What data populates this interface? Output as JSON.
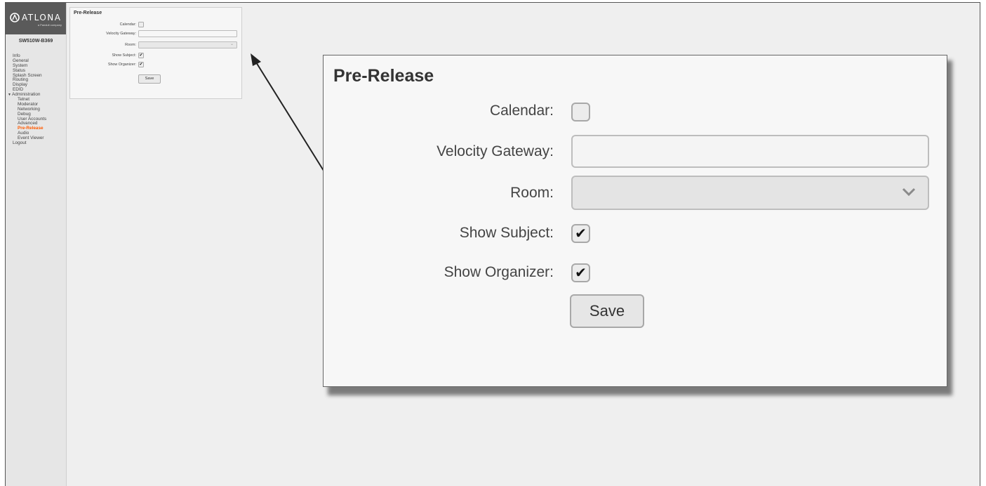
{
  "brand": {
    "logo_text": "ATLONA",
    "logo_sub": "a Panduit company",
    "accent_color": "#ff5a00"
  },
  "device": {
    "name": "SW510W-B369"
  },
  "sidebar": {
    "items": [
      {
        "label": "Info"
      },
      {
        "label": "General"
      },
      {
        "label": "System"
      },
      {
        "label": "Status"
      },
      {
        "label": "Splash Screen"
      },
      {
        "label": "Routing"
      },
      {
        "label": "Display"
      },
      {
        "label": "EDID"
      },
      {
        "label": "Administration",
        "expanded": true
      },
      {
        "label": "Telnet"
      },
      {
        "label": "Moderator"
      },
      {
        "label": "Networking"
      },
      {
        "label": "Debug"
      },
      {
        "label": "User Accounts"
      },
      {
        "label": "Advanced"
      },
      {
        "label": "Pre-Release",
        "active": true
      },
      {
        "label": "Audio"
      },
      {
        "label": "Event Viewer"
      },
      {
        "label": "Logout"
      }
    ]
  },
  "form": {
    "title": "Pre-Release",
    "calendar_label": "Calendar:",
    "calendar_checked": false,
    "velocity_label": "Velocity Gateway:",
    "velocity_value": "",
    "room_label": "Room:",
    "room_value": "",
    "show_subject_label": "Show Subject:",
    "show_subject_checked": true,
    "show_organizer_label": "Show Organizer:",
    "show_organizer_checked": true,
    "save_label": "Save",
    "checkmark": "✔"
  }
}
